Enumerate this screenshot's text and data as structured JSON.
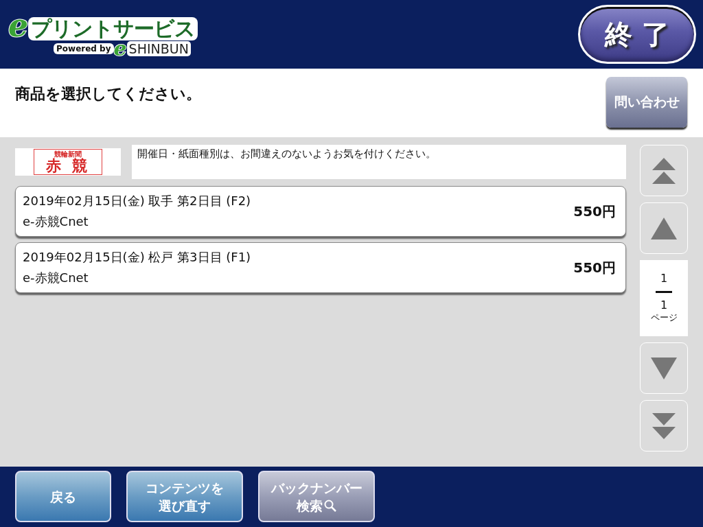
{
  "header": {
    "logo": {
      "mark": "e",
      "title": "プリントサービス",
      "powered_by": "Powered by",
      "brand_mark": "e",
      "brand": "SHINBUN"
    },
    "exit_button": "終 了"
  },
  "prompt": {
    "text": "商品を選択してください。",
    "inquiry_button": "問い合わせ"
  },
  "newspaper": {
    "logo_small": "競輪新聞",
    "logo_large": "赤 競",
    "notice": "開催日・紙面種別は、お間違えのないようお気を付けください。"
  },
  "items": [
    {
      "title": "2019年02月15日(金) 取手 第2日目 (F2)",
      "subtitle": "e-赤競Cnet",
      "price": "550円"
    },
    {
      "title": "2019年02月15日(金) 松戸 第3日目 (F1)",
      "subtitle": "e-赤競Cnet",
      "price": "550円"
    }
  ],
  "pager": {
    "buttons": [
      {
        "kind": "first"
      },
      {
        "kind": "prev"
      },
      {
        "kind": "next"
      },
      {
        "kind": "last"
      }
    ],
    "current": "1",
    "total": "1",
    "unit": "ページ"
  },
  "footer_buttons": [
    {
      "kind": "blue",
      "lines": [
        "戻る"
      ],
      "search_icon": false
    },
    {
      "kind": "blue",
      "lines": [
        "コンテンツを",
        "選び直す"
      ],
      "search_icon": false
    },
    {
      "kind": "grey",
      "lines": [
        "バックナンバー",
        "検索"
      ],
      "search_icon": true
    }
  ]
}
